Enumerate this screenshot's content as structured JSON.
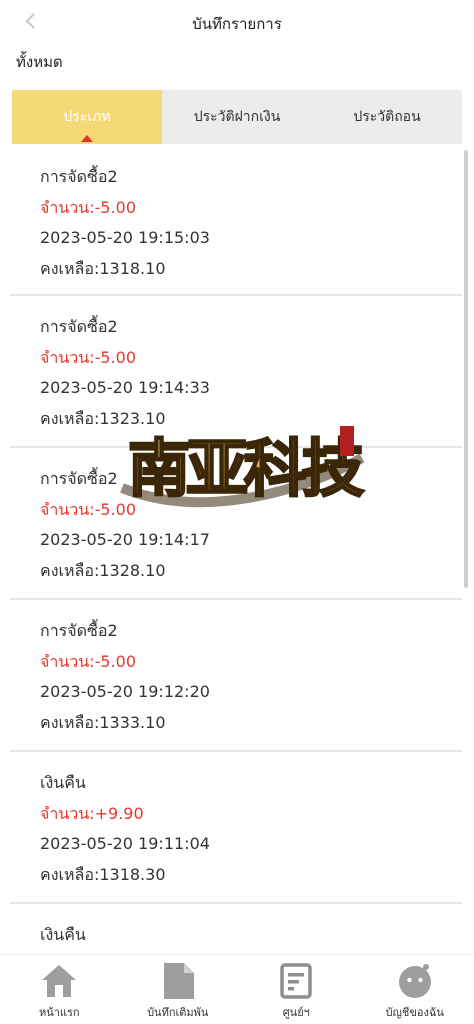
{
  "header": {
    "title": "บันทึกรายการ"
  },
  "filter": {
    "label": "ทั้งหมด"
  },
  "tabs": [
    {
      "label": "ประเภท",
      "active": true
    },
    {
      "label": "ประวัติฝากเงิน",
      "active": false
    },
    {
      "label": "ประวัติถอน",
      "active": false
    }
  ],
  "records": [
    {
      "title": "การจัดซื้อ2",
      "amount": "จำนวน:-5.00",
      "datetime": "2023-05-20 19:15:03",
      "balance": "คงเหลือ:1318.10"
    },
    {
      "title": "การจัดซื้อ2",
      "amount": "จำนวน:-5.00",
      "datetime": "2023-05-20 19:14:33",
      "balance": "คงเหลือ:1323.10"
    },
    {
      "title": "การจัดซื้อ2",
      "amount": "จำนวน:-5.00",
      "datetime": "2023-05-20 19:14:17",
      "balance": "คงเหลือ:1328.10"
    },
    {
      "title": "การจัดซื้อ2",
      "amount": "จำนวน:-5.00",
      "datetime": "2023-05-20 19:12:20",
      "balance": "คงเหลือ:1333.10"
    },
    {
      "title": "เงินคืน",
      "amount": "จำนวน:+9.90",
      "datetime": "2023-05-20 19:11:04",
      "balance": "คงเหลือ:1318.30"
    },
    {
      "title": "เงินคืน",
      "amount": "",
      "datetime": "",
      "balance": ""
    }
  ],
  "watermark": {
    "text": "南亚科技"
  },
  "bottom_nav": [
    {
      "label": "หน้าแรก",
      "icon": "home-icon"
    },
    {
      "label": "บันทึกเติมพัน",
      "icon": "document-icon"
    },
    {
      "label": "ศูนย์ฯ",
      "icon": "notes-icon"
    },
    {
      "label": "บัญชีของฉัน",
      "icon": "user-icon"
    }
  ],
  "colors": {
    "active_tab": "#f6d977",
    "caret": "#d9352b",
    "amount": "#e23a2f",
    "nav_icon": "#9e9e9e"
  }
}
